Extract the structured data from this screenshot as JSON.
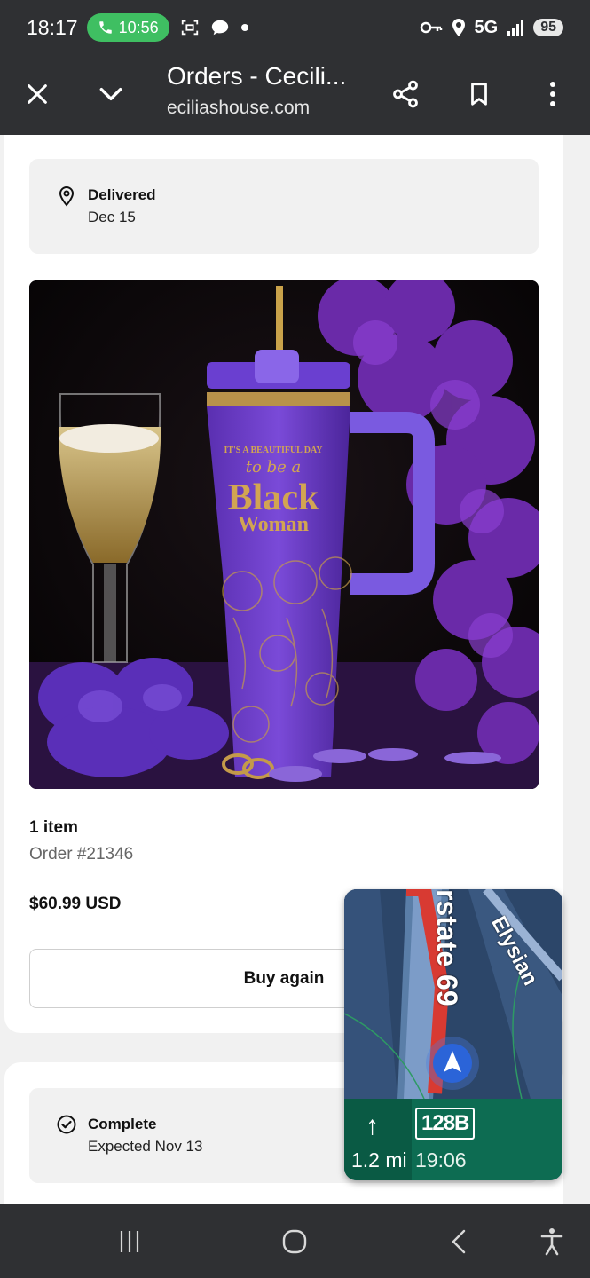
{
  "status_bar": {
    "time": "18:17",
    "call_timer": "10:56",
    "network": "5G",
    "battery": "95"
  },
  "toolbar": {
    "title": "Orders - Cecili...",
    "url": "eciliashouse.com"
  },
  "order": {
    "delivery_status": "Delivered",
    "delivery_date": "Dec 15",
    "item_count": "1 item",
    "order_number": "Order #21346",
    "price": "$60.99 USD",
    "buy_again_label": "Buy again",
    "product_text": {
      "line1": "IT'S A BEAUTIFUL DAY",
      "line2": "to be a",
      "line3": "Black",
      "line4": "Woman"
    }
  },
  "second_order": {
    "status": "Complete",
    "expected": "Expected Nov 13"
  },
  "maps_pip": {
    "road_1": "rstate 69",
    "road_2": "Elysian",
    "exit": "128B",
    "distance": "1.2 mi",
    "eta": "19:06",
    "arrow": "↑"
  },
  "colors": {
    "bar_bg": "#2f3033",
    "call_pill": "#3fbf62",
    "maps_green": "#0d6c52"
  }
}
